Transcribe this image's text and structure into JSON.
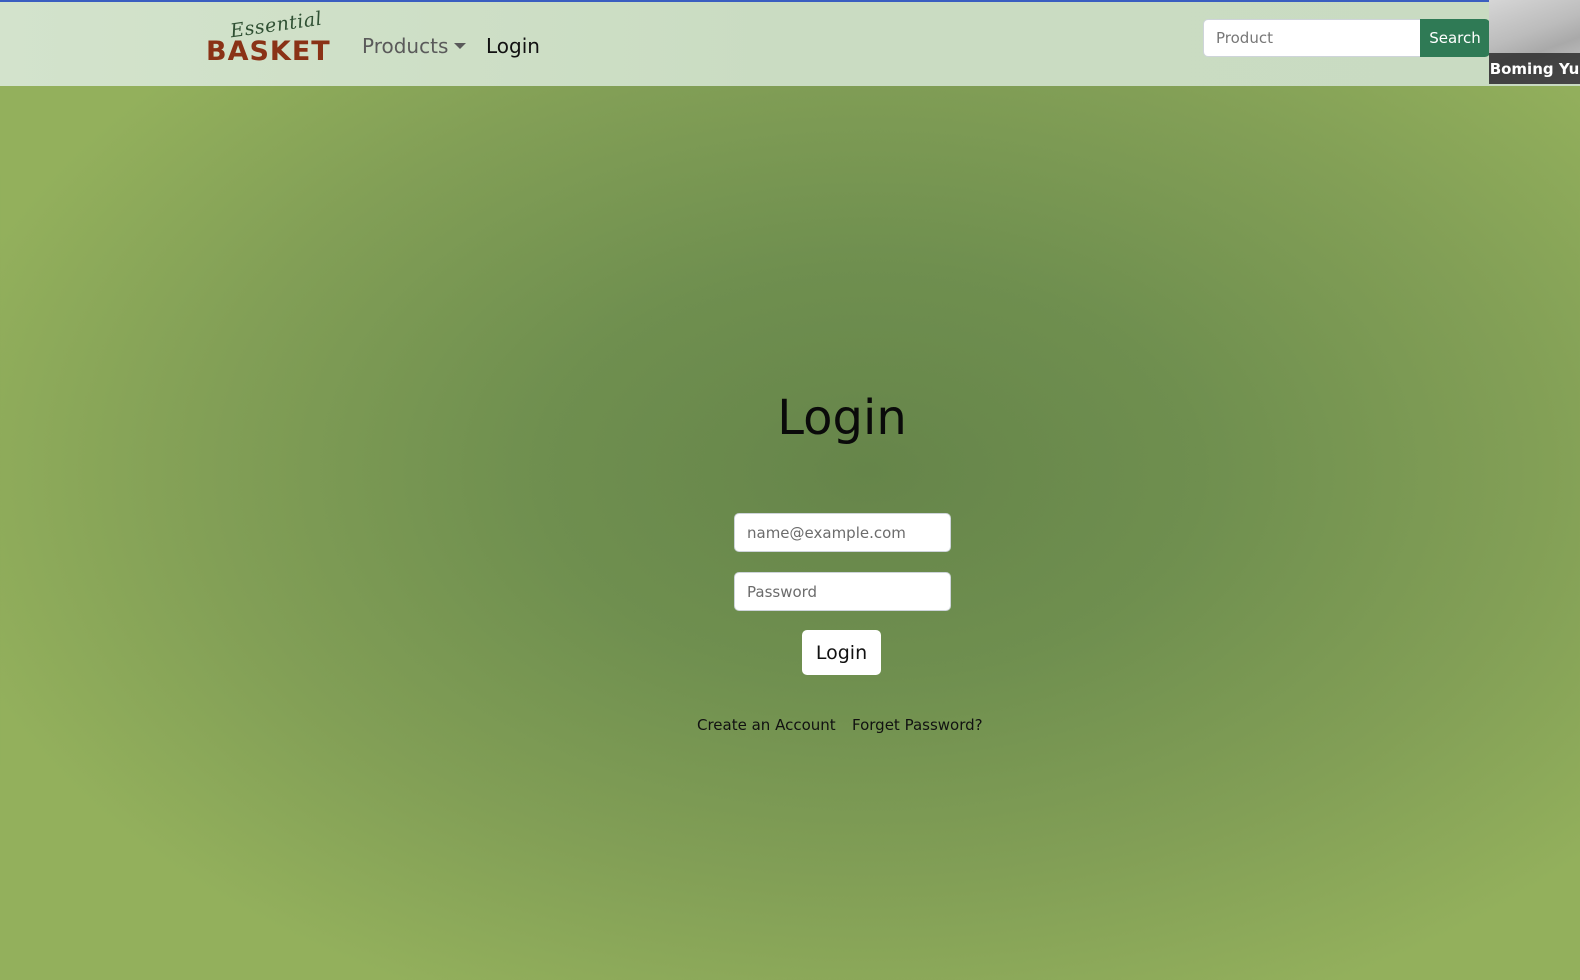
{
  "brand": {
    "script_text": "Essential",
    "main_text": "BASKET"
  },
  "nav": {
    "products_label": "Products",
    "login_label": "Login"
  },
  "search": {
    "placeholder": "Product",
    "button_label": "Search"
  },
  "video_overlay": {
    "participant_name": "Boming Yu"
  },
  "login_form": {
    "title": "Login",
    "email_placeholder": "name@example.com",
    "password_placeholder": "Password",
    "submit_label": "Login",
    "create_account_label": "Create an Account",
    "forgot_password_label": "Forget Password?"
  },
  "colors": {
    "search_button": "#2f7a55",
    "logo_main": "#8a3216",
    "background_center": "#66854a",
    "background_edge": "#93b05c"
  }
}
